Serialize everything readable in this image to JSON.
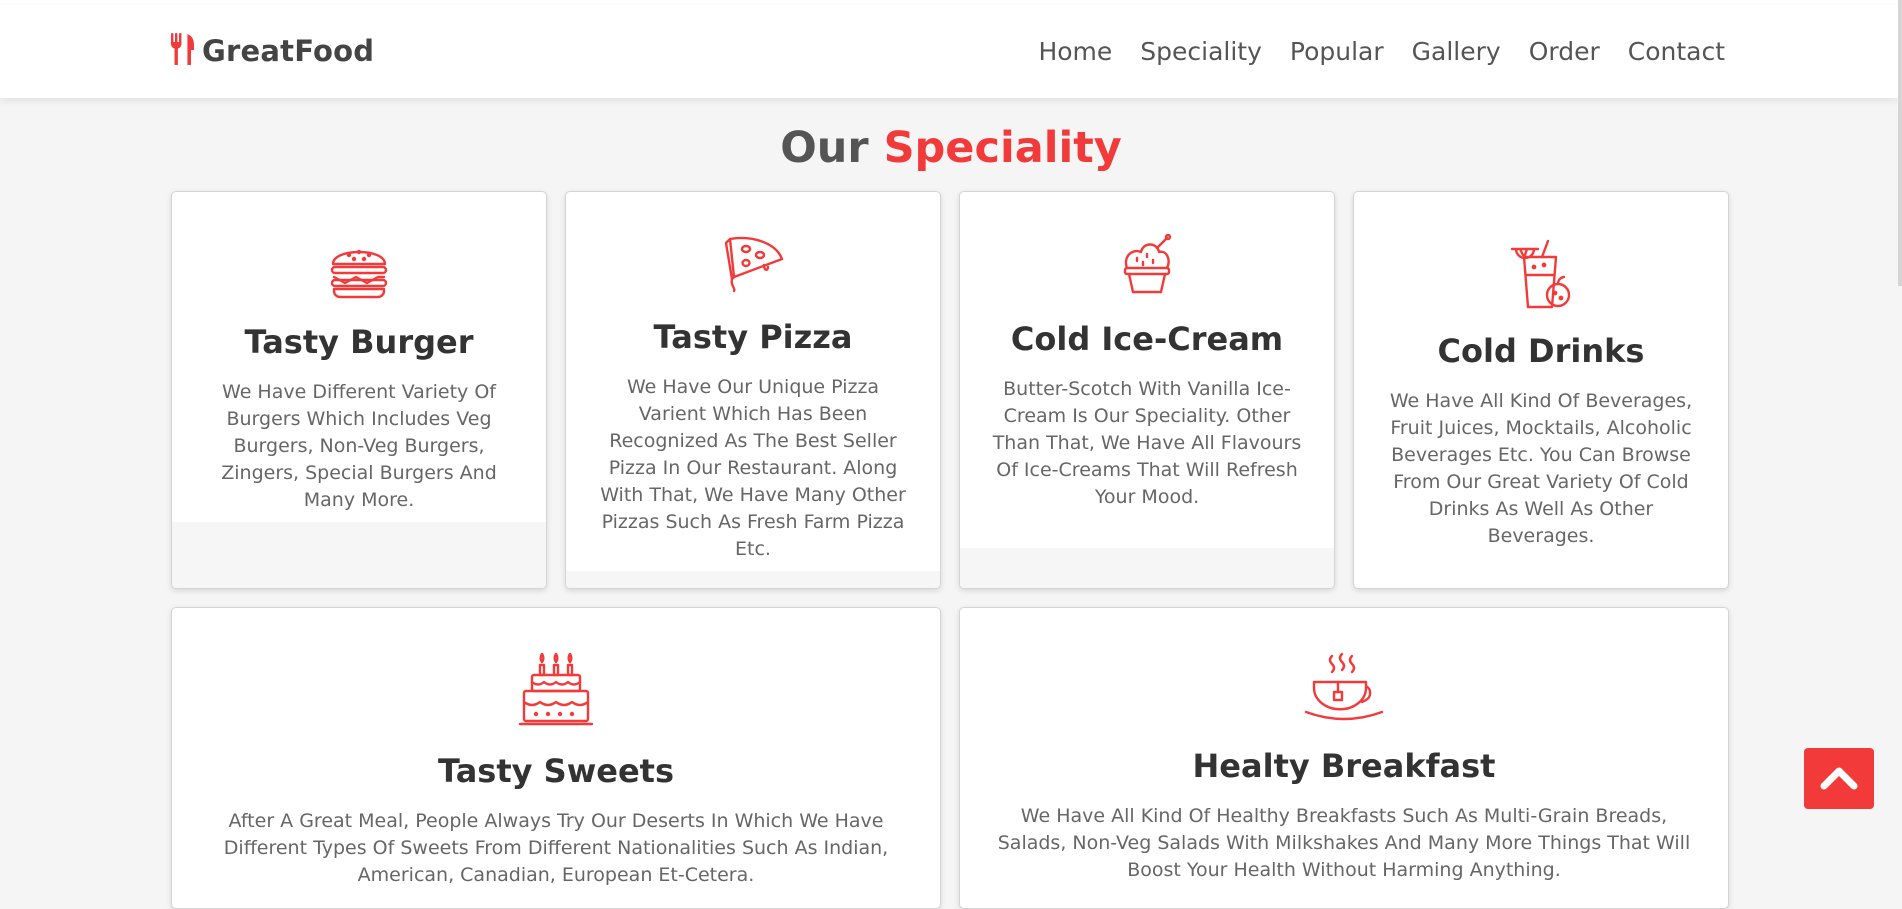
{
  "brand": {
    "name": "GreatFood",
    "icon": "fork-knife-icon",
    "accent_color": "#f33a3a"
  },
  "nav": {
    "items": [
      "Home",
      "Speciality",
      "Popular",
      "Gallery",
      "Order",
      "Contact"
    ]
  },
  "section": {
    "title_prefix": "Our",
    "title_accent": "Speciality"
  },
  "cards": [
    {
      "icon": "burger-icon",
      "title": "Tasty Burger",
      "desc": "We Have Different Variety Of Burgers Which Includes Veg Burgers, Non-Veg Burgers, Zingers, Special Burgers And Many More."
    },
    {
      "icon": "pizza-icon",
      "title": "Tasty Pizza",
      "desc": "We Have Our Unique Pizza Varient Which Has Been Recognized As The Best Seller Pizza In Our Restaurant. Along With That, We Have Many Other Pizzas Such As Fresh Farm Pizza Etc."
    },
    {
      "icon": "ice-cream-icon",
      "title": "Cold Ice-Cream",
      "desc": "Butter-Scotch With Vanilla Ice-Cream Is Our Speciality. Other Than That, We Have All Flavours Of Ice-Creams That Will Refresh Your Mood."
    },
    {
      "icon": "drink-icon",
      "title": "Cold Drinks",
      "desc": "We Have All Kind Of Beverages, Fruit Juices, Mocktails, Alcoholic Beverages Etc. You Can Browse From Our Great Variety Of Cold Drinks As Well As Other Beverages."
    },
    {
      "icon": "cake-icon",
      "title": "Tasty Sweets",
      "desc": "After A Great Meal, People Always Try Our Deserts In Which We Have Different Types Of Sweets From Different Nationalities Such As Indian, American, Canadian, European Et-Cetera."
    },
    {
      "icon": "coffee-cup-icon",
      "title": "Healty Breakfast",
      "desc": "We Have All Kind Of Healthy Breakfasts Such As Multi-Grain Breads, Salads, Non-Veg Salads With Milkshakes And Many More Things That Will Boost Your Health Without Harming Anything."
    }
  ],
  "scroll_top": {
    "icon": "chevron-up-icon"
  }
}
